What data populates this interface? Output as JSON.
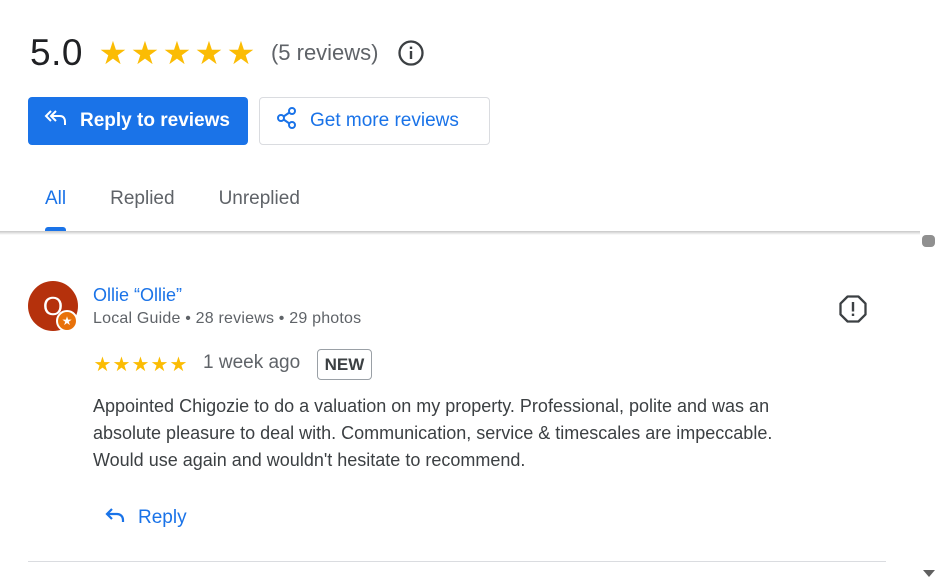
{
  "summary": {
    "score": "5.0",
    "stars": 5,
    "count": "(5 reviews)"
  },
  "actions": {
    "reply_label": "Reply to reviews",
    "get_more_label": "Get more reviews"
  },
  "tabs": [
    {
      "label": "All",
      "active": true
    },
    {
      "label": "Replied",
      "active": false
    },
    {
      "label": "Unreplied",
      "active": false
    }
  ],
  "review": {
    "avatar_initial": "O",
    "name": "Ollie “Ollie”",
    "meta": "Local Guide • 28 reviews • 29 photos",
    "rating": 5,
    "time": "1 week ago",
    "badge": "NEW",
    "lines": [
      "Appointed Chigozie to do a valuation on my property. Professional, polite and was an",
      "absolute pleasure to deal with. Communication, service & timescales are impeccable.",
      "Would use again and wouldn't hesitate to recommend."
    ],
    "reply_label": "Reply"
  },
  "colors": {
    "accent": "#1a73e8",
    "star": "#fbbc04",
    "avatar": "#b5310c",
    "badge": "#e8710a"
  }
}
